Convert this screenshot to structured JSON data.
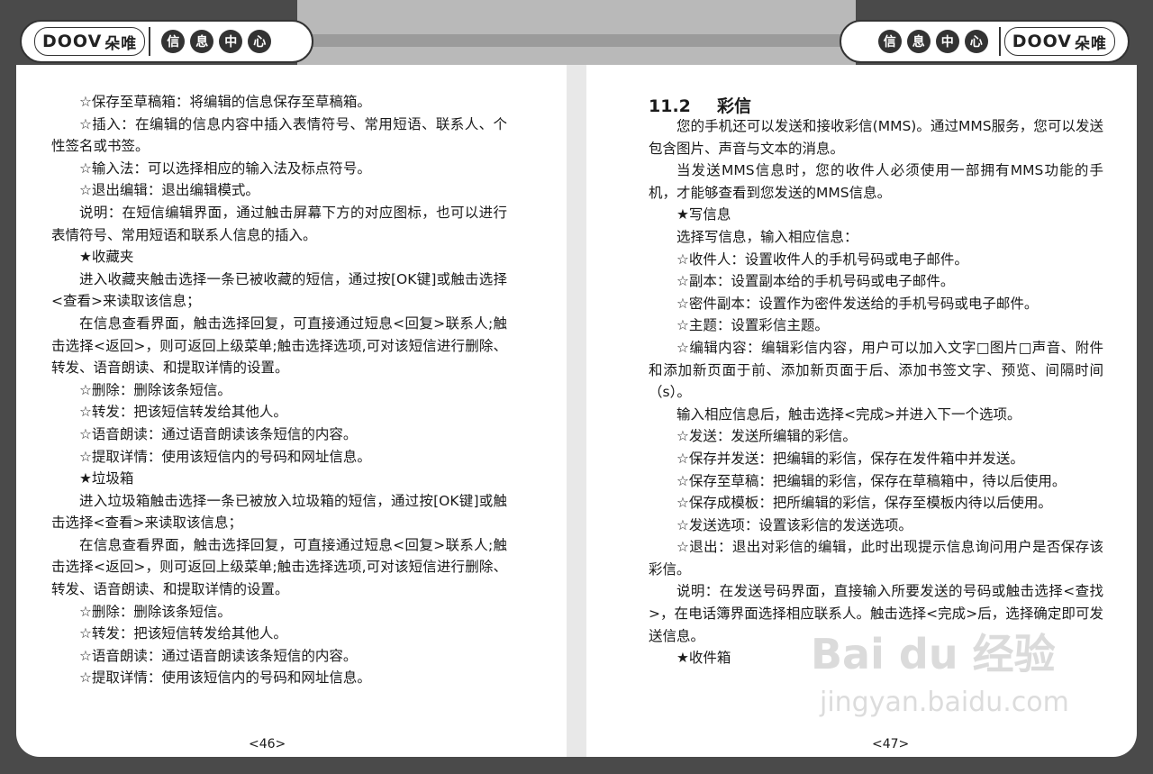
{
  "header": {
    "brand": "DOOV",
    "brand_cn": "朵唯",
    "section_chars": [
      "信",
      "息",
      "中",
      "心"
    ]
  },
  "left_page": {
    "paragraphs": [
      {
        "text": "☆保存至草稿箱：将编辑的信息保存至草稿箱。",
        "indent": true
      },
      {
        "text": "☆插入：在编辑的信息内容中插入表情符号、常用短语、联系人、个性签名或书签。",
        "indent": true
      },
      {
        "text": "☆输入法：可以选择相应的输入法及标点符号。",
        "indent": true
      },
      {
        "text": "☆退出编辑：退出编辑模式。",
        "indent": true
      },
      {
        "text": "说明：在短信编辑界面，通过触击屏幕下方的对应图标，也可以进行表情符号、常用短语和联系人信息的插入。",
        "indent": true
      },
      {
        "text": "★收藏夹",
        "indent": true
      },
      {
        "text": "进入收藏夹触击选择一条已被收藏的短信，通过按[OK键]或触击选择<查看>来读取该信息；",
        "indent": true
      },
      {
        "text": "在信息查看界面，触击选择回复，可直接通过短息<回复>联系人;触击选择<返回>，则可返回上级菜单;触击选择选项,可对该短信进行删除、转发、语音朗读、和提取详情的设置。",
        "indent": true
      },
      {
        "text": "☆删除：删除该条短信。",
        "indent": true
      },
      {
        "text": "☆转发：把该短信转发给其他人。",
        "indent": true
      },
      {
        "text": "☆语音朗读：通过语音朗读该条短信的内容。",
        "indent": true
      },
      {
        "text": "☆提取详情：使用该短信内的号码和网址信息。",
        "indent": true
      },
      {
        "text": "★垃圾箱",
        "indent": true
      },
      {
        "text": "进入垃圾箱触击选择一条已被放入垃圾箱的短信，通过按[OK键]或触击选择<查看>来读取该信息；",
        "indent": true
      },
      {
        "text": "在信息查看界面，触击选择回复，可直接通过短息<回复>联系人;触击选择<返回>，则可返回上级菜单;触击选择选项,可对该短信进行删除、转发、语音朗读、和提取详情的设置。",
        "indent": true
      },
      {
        "text": "☆删除：删除该条短信。",
        "indent": true
      },
      {
        "text": "☆转发：把该短信转发给其他人。",
        "indent": true
      },
      {
        "text": "☆语音朗读：通过语音朗读该条短信的内容。",
        "indent": true
      },
      {
        "text": "☆提取详情：使用该短信内的号码和网址信息。",
        "indent": true
      }
    ],
    "page_number": "<46>"
  },
  "right_page": {
    "section_number": "11.2",
    "section_title": "彩信",
    "paragraphs": [
      {
        "text": "您的手机还可以发送和接收彩信(MMS)。通过MMS服务，您可以发送包含图片、声音与文本的消息。",
        "indent": true
      },
      {
        "text": "当发送MMS信息时，您的收件人必须使用一部拥有MMS功能的手机，才能够查看到您发送的MMS信息。",
        "indent": true
      },
      {
        "text": "★写信息",
        "indent": true
      },
      {
        "text": "选择写信息，输入相应信息：",
        "indent": true
      },
      {
        "text": "☆收件人：设置收件人的手机号码或电子邮件。",
        "indent": true
      },
      {
        "text": "☆副本：设置副本给的手机号码或电子邮件。",
        "indent": true
      },
      {
        "text": "☆密件副本：设置作为密件发送给的手机号码或电子邮件。",
        "indent": true
      },
      {
        "text": "☆主题：设置彩信主题。",
        "indent": true
      },
      {
        "text": "☆编辑内容：编辑彩信内容，用户可以加入文字□图片□声音、附件和添加新页面于前、添加新页面于后、添加书签文字、预览、间隔时间（s）。",
        "indent": true
      },
      {
        "text": "输入相应信息后，触击选择<完成>并进入下一个选项。",
        "indent": true
      },
      {
        "text": "☆发送：发送所编辑的彩信。",
        "indent": true
      },
      {
        "text": "☆保存并发送：把编辑的彩信，保存在发件箱中并发送。",
        "indent": true
      },
      {
        "text": "☆保存至草稿：把编辑的彩信，保存在草稿箱中，待以后使用。",
        "indent": true
      },
      {
        "text": "☆保存成模板：把所编辑的彩信，保存至模板内待以后使用。",
        "indent": true
      },
      {
        "text": "☆发送选项：设置该彩信的发送选项。",
        "indent": true
      },
      {
        "text": "☆退出：退出对彩信的编辑，此时出现提示信息询问用户是否保存该彩信。",
        "indent": true
      },
      {
        "text": "说明：在发送号码界面，直接输入所要发送的号码或触击选择<查找>，在电话簿界面选择相应联系人。触击选择<完成>后，选择确定即可发送信息。",
        "indent": true
      },
      {
        "text": "★收件箱",
        "indent": true
      }
    ],
    "page_number": "<47>"
  },
  "watermark": {
    "line1": "Bai du 经验",
    "line2": "jingyan.baidu.com"
  }
}
